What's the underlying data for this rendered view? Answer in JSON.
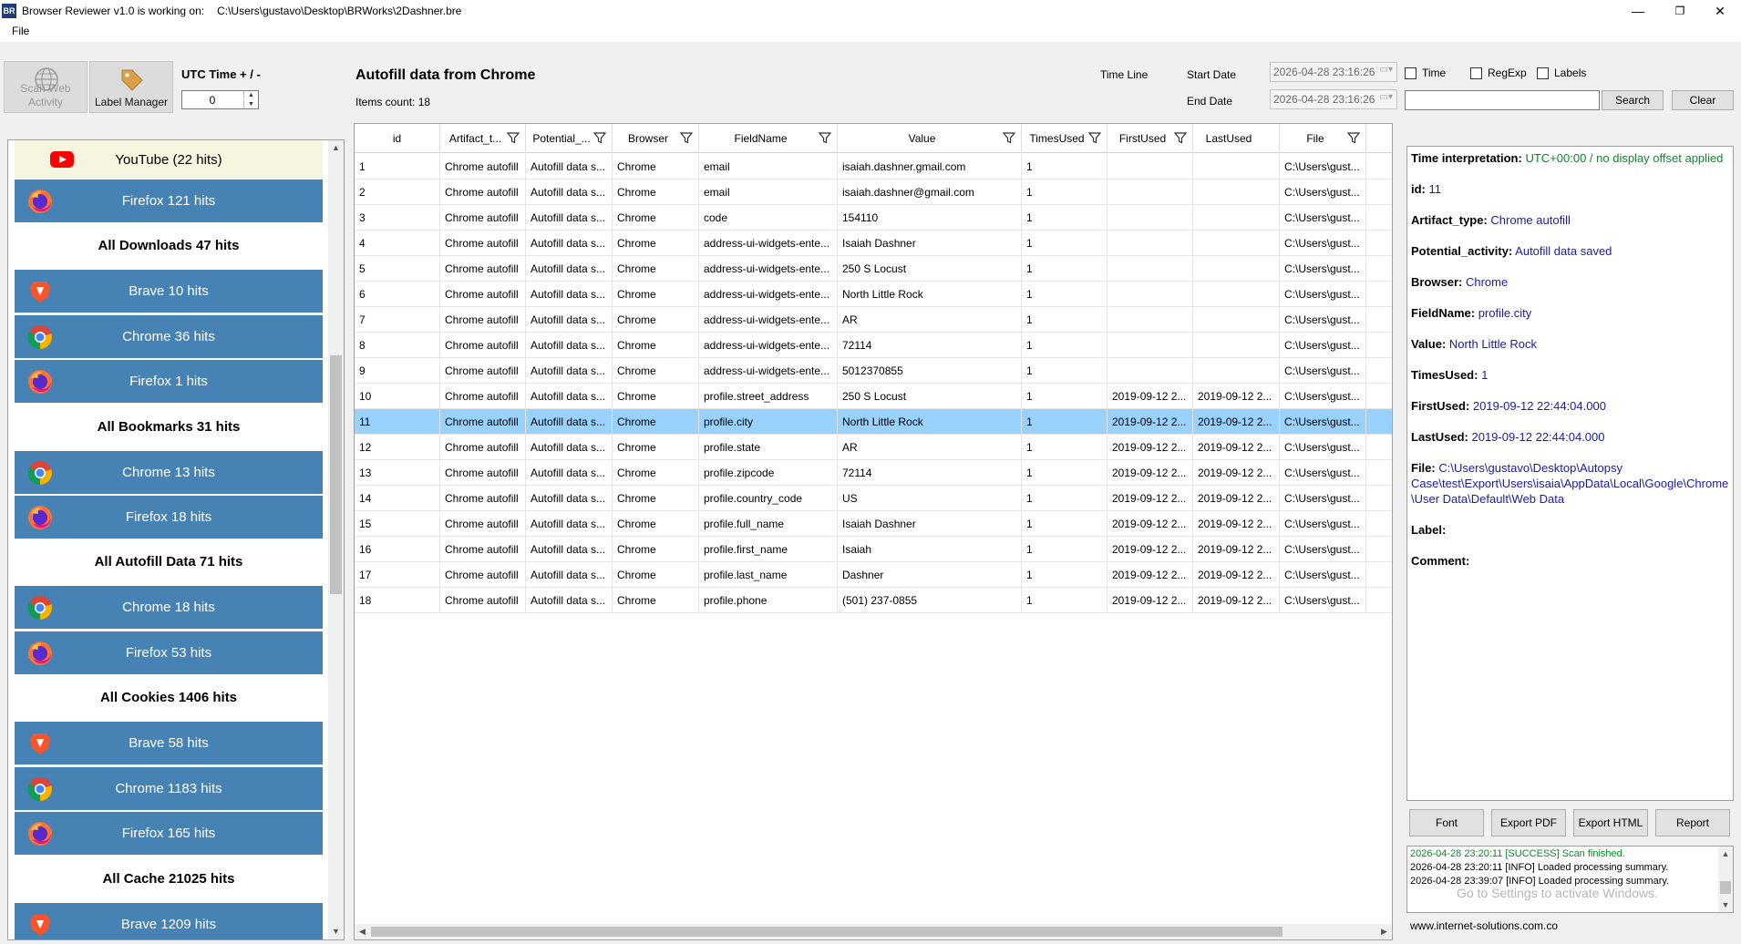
{
  "titlebar": {
    "icon_text": "BR",
    "title": "Browser Reviewer v1.0 is working on:",
    "path": "C:\\Users\\gustavo\\Desktop\\BRWorks\\2Dashner.bre",
    "minimize": "—",
    "restore": "❐",
    "close": "✕"
  },
  "menu": {
    "file": "File"
  },
  "toolbar": {
    "scan_label_1": "Scan Web",
    "scan_label_2": "Activity",
    "label_manager": "Label Manager",
    "utc_label": "UTC Time + / -",
    "utc_value": "0"
  },
  "header": {
    "title": "Autofill data from Chrome",
    "items_count": "Items count: 18",
    "timeline": "Time Line",
    "start_date_label": "Start Date",
    "end_date_label": "End Date",
    "start_date": "2026-04-28 23:16:26",
    "end_date": "2026-04-28 23:16:26",
    "chk_time": "Time",
    "chk_regexp": "RegExp",
    "chk_labels": "Labels",
    "search_btn": "Search",
    "clear_btn": "Clear"
  },
  "sources": [
    {
      "label": "YouTube (22 hits)",
      "style": "yt",
      "icon": "youtube-icon"
    },
    {
      "label": "Firefox 121 hits",
      "style": "blue",
      "icon": "firefox-icon"
    },
    {
      "label": "All Downloads 47 hits",
      "style": "hdr",
      "icon": ""
    },
    {
      "label": "Brave 10 hits",
      "style": "blue",
      "icon": "brave-icon"
    },
    {
      "label": "Chrome 36 hits",
      "style": "blue",
      "icon": "chrome-icon"
    },
    {
      "label": "Firefox 1 hits",
      "style": "blue",
      "icon": "firefox-icon"
    },
    {
      "label": "All Bookmarks 31 hits",
      "style": "hdr",
      "icon": ""
    },
    {
      "label": "Chrome 13 hits",
      "style": "blue",
      "icon": "chrome-icon"
    },
    {
      "label": "Firefox 18 hits",
      "style": "blue",
      "icon": "firefox-icon"
    },
    {
      "label": "All Autofill Data 71 hits",
      "style": "hdr",
      "icon": ""
    },
    {
      "label": "Chrome 18 hits",
      "style": "blue",
      "icon": "chrome-icon"
    },
    {
      "label": "Firefox 53 hits",
      "style": "blue",
      "icon": "firefox-icon"
    },
    {
      "label": "All Cookies 1406 hits",
      "style": "hdr",
      "icon": ""
    },
    {
      "label": "Brave 58 hits",
      "style": "blue",
      "icon": "brave-icon"
    },
    {
      "label": "Chrome 1183 hits",
      "style": "blue",
      "icon": "chrome-icon"
    },
    {
      "label": "Firefox 165 hits",
      "style": "blue",
      "icon": "firefox-icon"
    },
    {
      "label": "All Cache 21025 hits",
      "style": "hdr",
      "icon": ""
    },
    {
      "label": "Brave 1209 hits",
      "style": "blue",
      "icon": "brave-icon"
    }
  ],
  "grid": {
    "columns": [
      "id",
      "Artifact_t...",
      "Potential_...",
      "Browser",
      "FieldName",
      "Value",
      "TimesUsed",
      "FirstUsed",
      "LastUsed",
      "File"
    ],
    "rows": [
      [
        "1",
        "Chrome autofill",
        "Autofill data s...",
        "Chrome",
        "email",
        "isaiah.dashner.gmail.com",
        "1",
        "",
        "",
        "C:\\Users\\gust..."
      ],
      [
        "2",
        "Chrome autofill",
        "Autofill data s...",
        "Chrome",
        "email",
        "isaiah.dashner@gmail.com",
        "1",
        "",
        "",
        "C:\\Users\\gust..."
      ],
      [
        "3",
        "Chrome autofill",
        "Autofill data s...",
        "Chrome",
        "code",
        "154110",
        "1",
        "",
        "",
        "C:\\Users\\gust..."
      ],
      [
        "4",
        "Chrome autofill",
        "Autofill data s...",
        "Chrome",
        "address-ui-widgets-ente...",
        "Isaiah Dashner",
        "1",
        "",
        "",
        "C:\\Users\\gust..."
      ],
      [
        "5",
        "Chrome autofill",
        "Autofill data s...",
        "Chrome",
        "address-ui-widgets-ente...",
        "250 S Locust",
        "1",
        "",
        "",
        "C:\\Users\\gust..."
      ],
      [
        "6",
        "Chrome autofill",
        "Autofill data s...",
        "Chrome",
        "address-ui-widgets-ente...",
        "North Little Rock",
        "1",
        "",
        "",
        "C:\\Users\\gust..."
      ],
      [
        "7",
        "Chrome autofill",
        "Autofill data s...",
        "Chrome",
        "address-ui-widgets-ente...",
        "AR",
        "1",
        "",
        "",
        "C:\\Users\\gust..."
      ],
      [
        "8",
        "Chrome autofill",
        "Autofill data s...",
        "Chrome",
        "address-ui-widgets-ente...",
        "72114",
        "1",
        "",
        "",
        "C:\\Users\\gust..."
      ],
      [
        "9",
        "Chrome autofill",
        "Autofill data s...",
        "Chrome",
        "address-ui-widgets-ente...",
        "5012370855",
        "1",
        "",
        "",
        "C:\\Users\\gust..."
      ],
      [
        "10",
        "Chrome autofill",
        "Autofill data s...",
        "Chrome",
        "profile.street_address",
        "250 S Locust",
        "1",
        "2019-09-12 2...",
        "2019-09-12 2...",
        "C:\\Users\\gust..."
      ],
      [
        "11",
        "Chrome autofill",
        "Autofill data s...",
        "Chrome",
        "profile.city",
        "North Little Rock",
        "1",
        "2019-09-12 2...",
        "2019-09-12 2...",
        "C:\\Users\\gust..."
      ],
      [
        "12",
        "Chrome autofill",
        "Autofill data s...",
        "Chrome",
        "profile.state",
        "AR",
        "1",
        "2019-09-12 2...",
        "2019-09-12 2...",
        "C:\\Users\\gust..."
      ],
      [
        "13",
        "Chrome autofill",
        "Autofill data s...",
        "Chrome",
        "profile.zipcode",
        "72114",
        "1",
        "2019-09-12 2...",
        "2019-09-12 2...",
        "C:\\Users\\gust..."
      ],
      [
        "14",
        "Chrome autofill",
        "Autofill data s...",
        "Chrome",
        "profile.country_code",
        "US",
        "1",
        "2019-09-12 2...",
        "2019-09-12 2...",
        "C:\\Users\\gust..."
      ],
      [
        "15",
        "Chrome autofill",
        "Autofill data s...",
        "Chrome",
        "profile.full_name",
        "Isaiah Dashner",
        "1",
        "2019-09-12 2...",
        "2019-09-12 2...",
        "C:\\Users\\gust..."
      ],
      [
        "16",
        "Chrome autofill",
        "Autofill data s...",
        "Chrome",
        "profile.first_name",
        "Isaiah",
        "1",
        "2019-09-12 2...",
        "2019-09-12 2...",
        "C:\\Users\\gust..."
      ],
      [
        "17",
        "Chrome autofill",
        "Autofill data s...",
        "Chrome",
        "profile.last_name",
        "Dashner",
        "1",
        "2019-09-12 2...",
        "2019-09-12 2...",
        "C:\\Users\\gust..."
      ],
      [
        "18",
        "Chrome autofill",
        "Autofill data s...",
        "Chrome",
        "profile.phone",
        "(501) 237-0855",
        "1",
        "2019-09-12 2...",
        "2019-09-12 2...",
        "C:\\Users\\gust..."
      ]
    ],
    "selected_row": 10
  },
  "details": [
    {
      "key": "Time interpretation:",
      "value": "UTC+00:00 / no display offset applied",
      "green": true
    },
    {
      "key": "id:",
      "value": "11"
    },
    {
      "key": "Artifact_type:",
      "value": "Chrome autofill"
    },
    {
      "key": "Potential_activity:",
      "value": "Autofill data saved"
    },
    {
      "key": "Browser:",
      "value": "Chrome"
    },
    {
      "key": "FieldName:",
      "value": "profile.city"
    },
    {
      "key": "Value:",
      "value": "North Little Rock"
    },
    {
      "key": "TimesUsed:",
      "value": "1"
    },
    {
      "key": "FirstUsed:",
      "value": "2019-09-12 22:44:04.000"
    },
    {
      "key": "LastUsed:",
      "value": "2019-09-12 22:44:04.000"
    },
    {
      "key": "File:",
      "value": "C:\\Users\\gustavo\\Desktop\\Autopsy Case\\test\\Export\\Users\\isaia\\AppData\\Local\\Google\\Chrome\\User Data\\Default\\Web Data"
    },
    {
      "key": "Label:",
      "value": ""
    },
    {
      "key": "Comment:",
      "value": ""
    }
  ],
  "detail_buttons": {
    "font": "Font",
    "export_pdf": "Export PDF",
    "export_html": "Export HTML",
    "report": "Report"
  },
  "log": [
    {
      "text": "2026-04-28 23:20:11 [SUCCESS] Scan finished.",
      "color": "#0a8a2a"
    },
    {
      "text": "2026-04-28 23:20:11 [INFO] Loaded processing summary.",
      "color": "#000000"
    },
    {
      "text": "2026-04-28 23:39:07 [INFO] Loaded processing summary.",
      "color": "#000000"
    }
  ],
  "activate_text": "Go to Settings to activate Windows.",
  "footer_url": "www.internet-solutions.com.co",
  "colors": {
    "accent_blue": "#4682b4",
    "selected_row": "#99d1ff",
    "youtube_bg": "#f5f5e0"
  }
}
